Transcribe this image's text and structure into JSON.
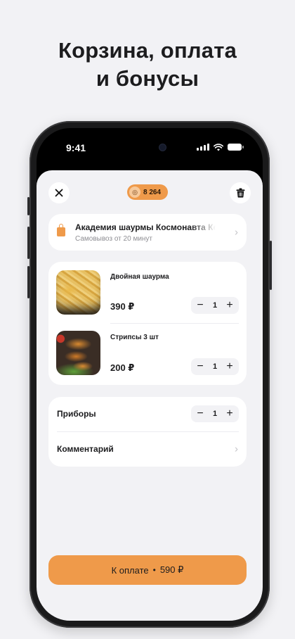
{
  "headline": {
    "line1": "Корзина, оплата",
    "line2": "и бонусы"
  },
  "status_bar": {
    "time": "9:41"
  },
  "topbar": {
    "close_icon": "close-icon",
    "trash_icon": "trash-icon",
    "bonus_value": "8 264",
    "bonus_icon": "coin-icon"
  },
  "restaurant": {
    "name": "Академия шаурмы Космонавта Комарова",
    "subtitle": "Самовывоз от 20 минут"
  },
  "cart": {
    "items": [
      {
        "name": "Двойная шаурма",
        "price": "390 ₽",
        "quantity": "1"
      },
      {
        "name": "Стрипсы 3 шт",
        "price": "200 ₽",
        "quantity": "1"
      }
    ],
    "minus": "−",
    "plus": "+"
  },
  "options": {
    "cutlery_label": "Приборы",
    "cutlery_quantity": "1",
    "comment_label": "Комментарий"
  },
  "checkout": {
    "label": "К оплате",
    "separator": "•",
    "total": "590 ₽"
  },
  "colors": {
    "accent": "#ef9a4a",
    "background": "#f2f2f5",
    "card": "#ffffff"
  }
}
